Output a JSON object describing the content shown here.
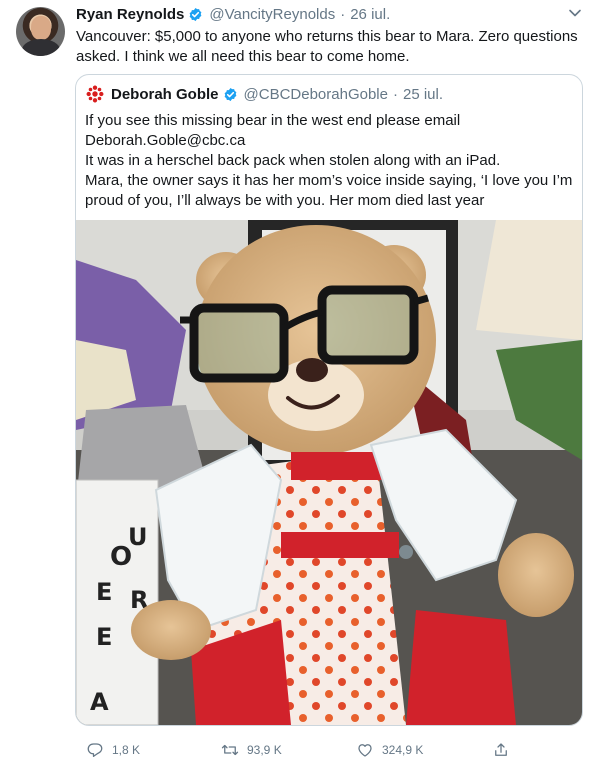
{
  "tweet": {
    "author_name": "Ryan Reynolds",
    "author_handle": "@VancityReynolds",
    "separator": "·",
    "date": "26 iul.",
    "text": "Vancouver: $5,000 to anyone who returns this bear to Mara. Zero questions asked. I think we all need this bear to come home.",
    "avatar_icon": "profile-photo",
    "verified_icon": "verified-badge-icon",
    "menu_icon": "chevron-down-icon"
  },
  "quoted": {
    "author_name": "Deborah Goble",
    "author_handle": "@CBCDeborahGoble",
    "separator": "·",
    "date": "25 iul.",
    "lines": [
      "If you see this missing bear in the west end please email",
      "Deborah.Goble@cbc.ca",
      "It was in a herschel back pack when stolen along with an iPad.",
      "Mara, the owner says it has her mom’s voice inside saying, ‘I love you I’m",
      "proud of you, I’ll always be with you. Her mom died last year"
    ],
    "icon": "cbc-logo-icon",
    "photo_icon": "teddy-bear-photo",
    "lightbox_letters": [
      "O",
      "U",
      "E",
      "R",
      "E",
      "A"
    ]
  },
  "actions": {
    "reply": "1,8 K",
    "retweet": "93,9 K",
    "like": "324,9 K",
    "reply_icon": "reply-icon",
    "retweet_icon": "retweet-icon",
    "like_icon": "heart-icon",
    "share_icon": "share-icon"
  },
  "colors": {
    "link_blue": "#1da1f2",
    "muted": "#657786",
    "cbc_red": "#d81e1e",
    "border": "#ccd6dd"
  }
}
